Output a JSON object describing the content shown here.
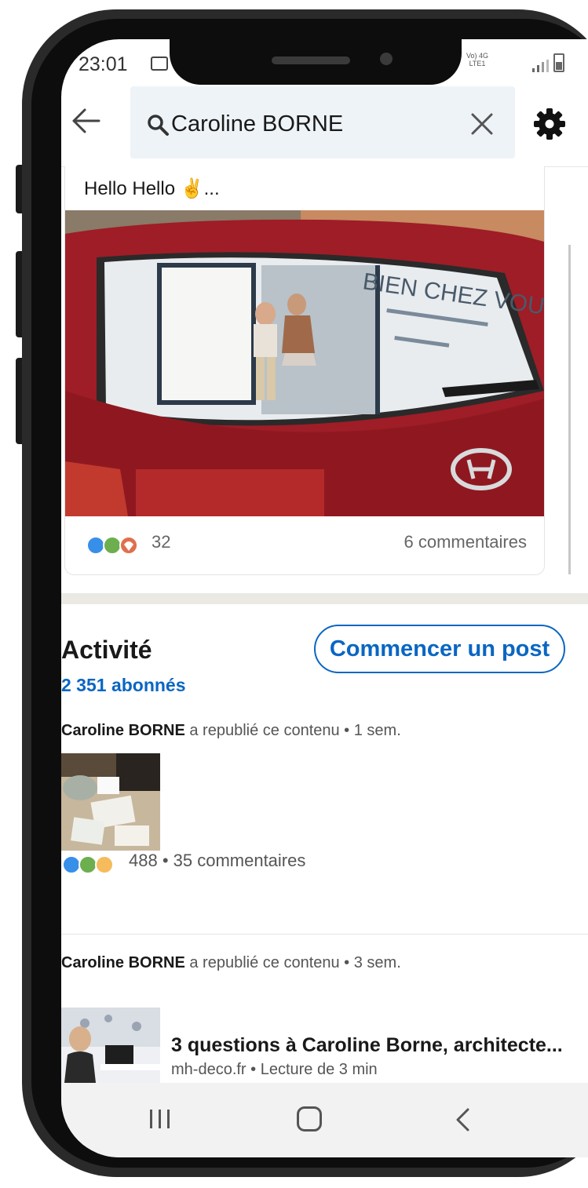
{
  "status_bar": {
    "time": "23:01",
    "network_top": "Vo) 4G",
    "network_bottom": "LTE1"
  },
  "search": {
    "query": "Caroline BORNE"
  },
  "post": {
    "text": "Hello Hello ✌️...",
    "image_text": "BIEN CHEZ VOUS",
    "reaction_count": "32",
    "comments": "6 commentaires"
  },
  "activity": {
    "title": "Activité",
    "followers": "2 351 abonnés",
    "start_post_label": "Commencer un post",
    "items": [
      {
        "author": "Caroline BORNE",
        "action": " a republié ce contenu • 1 sem.",
        "stats": "488 • 35 commentaires"
      },
      {
        "author": "Caroline BORNE",
        "action": " a republié ce contenu • 3 sem.",
        "article_title": "3 questions à Caroline Borne, architecte...",
        "article_meta": "mh-deco.fr • Lecture de 3 min"
      }
    ]
  },
  "icons": {
    "back": "arrow-left-icon",
    "search": "search-icon",
    "clear": "close-icon",
    "settings": "gear-icon"
  },
  "colors": {
    "accent": "#0a66c2",
    "search_bg": "#eef3f8",
    "car_red": "#b4232e"
  }
}
